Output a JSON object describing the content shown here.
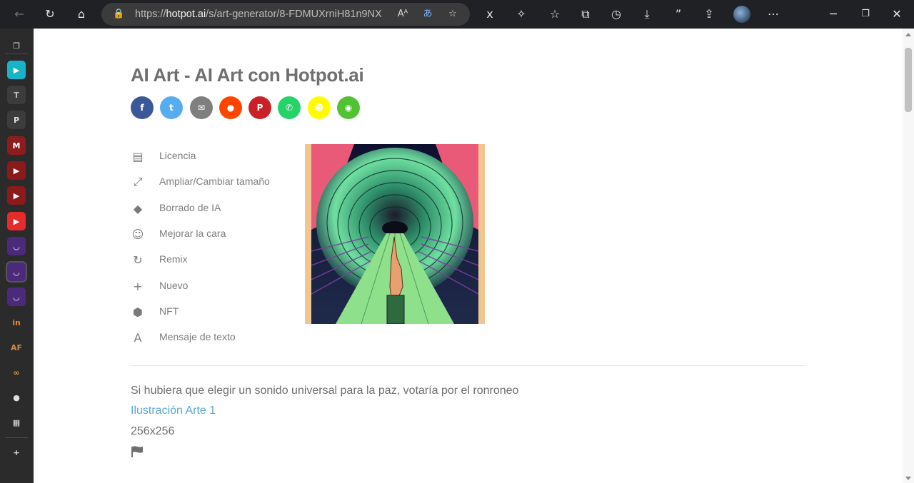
{
  "browser": {
    "url_prefix": "https://",
    "url_host": "hotpot.ai",
    "url_path": "/s/art-generator/8-FDMUXrniH81n9NX",
    "toolbar_icons": [
      "back-icon",
      "refresh-icon",
      "home-icon",
      "read-aloud-icon",
      "translate-icon",
      "favorite-add-icon",
      "reader-icon",
      "extensions-icon",
      "favorites-icon",
      "collections-icon",
      "history-icon",
      "downloads-icon",
      "quote-icon",
      "share-icon",
      "profile-avatar",
      "more-icon",
      "minimize-icon",
      "restore-icon",
      "close-icon"
    ]
  },
  "sidebar": {
    "items": [
      {
        "name": "tab-actions",
        "glyph": "❐",
        "color": "#2b2b2b",
        "fg": "#e0e0e0"
      },
      {
        "name": "sidebar-app-play",
        "glyph": "▶",
        "color": "#17b3c7",
        "fg": "#ffffff"
      },
      {
        "name": "sidebar-app-t",
        "glyph": "T",
        "color": "#3c3c3c",
        "fg": "#bdbdbd"
      },
      {
        "name": "sidebar-app-p",
        "glyph": "P",
        "color": "#3c3c3c",
        "fg": "#e0e0e0"
      },
      {
        "name": "sidebar-app-m",
        "glyph": "M",
        "color": "#8e1c1c",
        "fg": "#ffffff"
      },
      {
        "name": "sidebar-app-youtube-1",
        "glyph": "▶",
        "color": "#8b1a1a",
        "fg": "#ffffff"
      },
      {
        "name": "sidebar-app-youtube-2",
        "glyph": "▶",
        "color": "#8b1a1a",
        "fg": "#ffffff"
      },
      {
        "name": "sidebar-app-youtube-3",
        "glyph": "▶",
        "color": "#e52b2b",
        "fg": "#ffffff"
      },
      {
        "name": "sidebar-app-hotpot-1",
        "glyph": "◡",
        "color": "#4a2a7a",
        "fg": "#ffffff"
      },
      {
        "name": "sidebar-app-hotpot-2",
        "glyph": "◡",
        "color": "#4a2a7a",
        "fg": "#ffffff"
      },
      {
        "name": "sidebar-app-hotpot-3",
        "glyph": "◡",
        "color": "#4a2a7a",
        "fg": "#ffffff"
      },
      {
        "name": "sidebar-app-in",
        "glyph": "in",
        "color": "#2b2b2b",
        "fg": "#f08a1c"
      },
      {
        "name": "sidebar-app-af",
        "glyph": "AF",
        "color": "#2b2b2b",
        "fg": "#c98a4b"
      },
      {
        "name": "sidebar-app-infinity",
        "glyph": "∞",
        "color": "#2b2b2b",
        "fg": "#e0a030"
      },
      {
        "name": "sidebar-app-github",
        "glyph": "●",
        "color": "#2b2b2b",
        "fg": "#e0e0e0"
      },
      {
        "name": "sidebar-app-calendar",
        "glyph": "▦",
        "color": "#2b2b2b",
        "fg": "#e0e0e0"
      },
      {
        "name": "sidebar-add",
        "glyph": "+",
        "color": "#2b2b2b",
        "fg": "#e0e0e0"
      }
    ]
  },
  "page": {
    "title": "AI Art - AI Art con Hotpot.ai",
    "share_buttons": [
      {
        "name": "facebook",
        "glyph": "f",
        "color": "#3b5998"
      },
      {
        "name": "twitter",
        "glyph": "t",
        "color": "#55acee"
      },
      {
        "name": "email",
        "glyph": "✉",
        "color": "#7f7f7f"
      },
      {
        "name": "reddit",
        "glyph": "●",
        "color": "#ff4500"
      },
      {
        "name": "pinterest",
        "glyph": "P",
        "color": "#cb2027"
      },
      {
        "name": "whatsapp",
        "glyph": "✆",
        "color": "#25d366"
      },
      {
        "name": "snapchat",
        "glyph": "☻",
        "color": "#fffc00"
      },
      {
        "name": "wechat",
        "glyph": "◉",
        "color": "#51c332"
      }
    ],
    "menu": [
      {
        "name": "license",
        "icon": "license-icon",
        "glyph": "▤",
        "label": "Licencia"
      },
      {
        "name": "resize",
        "icon": "resize-icon",
        "glyph": "⤢",
        "label": "Ampliar/Cambiar tamaño"
      },
      {
        "name": "ai-eraser",
        "icon": "eraser-icon",
        "glyph": "◆",
        "label": "Borrado de IA"
      },
      {
        "name": "enhance-face",
        "icon": "face-icon",
        "glyph": "☺",
        "label": "Mejorar la cara"
      },
      {
        "name": "remix",
        "icon": "remix-icon",
        "glyph": "↻",
        "label": "Remix"
      },
      {
        "name": "new",
        "icon": "new-icon",
        "glyph": "+",
        "label": "Nuevo"
      },
      {
        "name": "nft",
        "icon": "nft-icon",
        "glyph": "⬢",
        "label": "NFT"
      },
      {
        "name": "text-prompt",
        "icon": "text-icon",
        "glyph": "A",
        "label": "Mensaje de texto"
      }
    ],
    "caption": "Si hubiera que elegir un sonido universal para la paz, votaría por el ronroneo",
    "style_link": "Ilustración Arte 1",
    "image_size": "256x256"
  }
}
